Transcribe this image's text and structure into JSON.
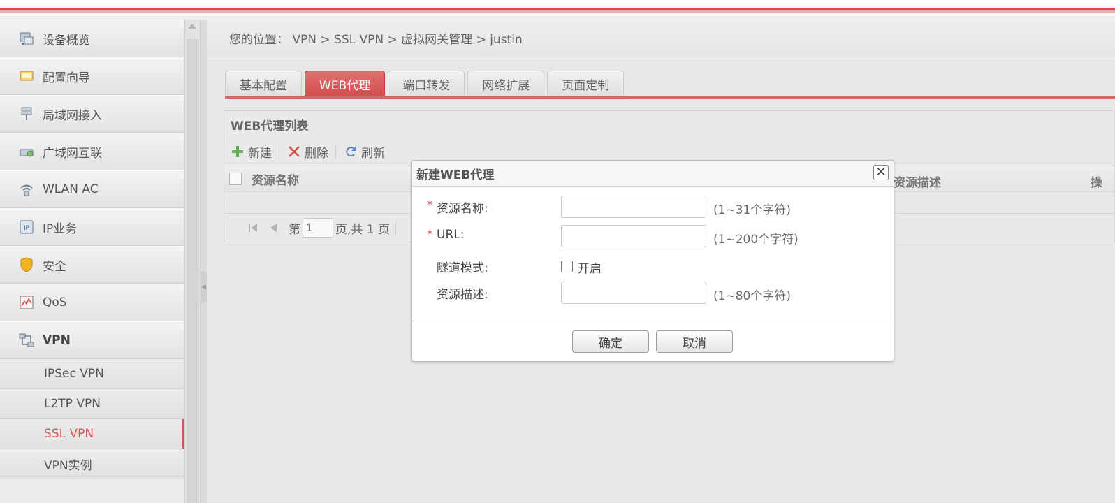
{
  "breadcrumb": "您的位置： VPN > SSL VPN > 虚拟网关管理 > justin",
  "sidebar": {
    "items": [
      {
        "label": "设备概览",
        "icon": "device-overview-icon"
      },
      {
        "label": "配置向导",
        "icon": "config-wizard-icon"
      },
      {
        "label": "局域网接入",
        "icon": "lan-access-icon"
      },
      {
        "label": "广域网互联",
        "icon": "wan-interconnect-icon"
      },
      {
        "label": "WLAN AC",
        "icon": "wlan-icon"
      },
      {
        "label": "IP业务",
        "icon": "ip-service-icon"
      },
      {
        "label": "安全",
        "icon": "shield-icon"
      },
      {
        "label": "QoS",
        "icon": "qos-icon"
      },
      {
        "label": "VPN",
        "icon": "vpn-icon"
      }
    ],
    "vpn_subitems": [
      "IPSec VPN",
      "L2TP VPN",
      "SSL VPN",
      "VPN实例"
    ],
    "selected_subitem": "SSL VPN"
  },
  "tabs": [
    "基本配置",
    "WEB代理",
    "端口转发",
    "网络扩展",
    "页面定制"
  ],
  "active_tab": "WEB代理",
  "panel": {
    "title": "WEB代理列表",
    "toolbar": {
      "new": "新建",
      "delete": "删除",
      "refresh": "刷新"
    },
    "columns": {
      "name": "资源名称",
      "desc": "资源描述",
      "more": "操"
    },
    "pager": {
      "prefix": "第",
      "page_value": "1",
      "suffix": "页,共 1 页"
    }
  },
  "dialog": {
    "title": "新建WEB代理",
    "required_mark": "*",
    "fields": {
      "name": {
        "label": "资源名称:",
        "hint": "(1~31个字符)",
        "value": ""
      },
      "url": {
        "label": "URL:",
        "hint": "(1~200个字符)",
        "value": ""
      },
      "tunnel": {
        "label": "隧道模式:",
        "checkbox_label": "开启",
        "checked": false
      },
      "desc": {
        "label": "资源描述:",
        "hint": "(1~80个字符)",
        "value": ""
      }
    },
    "ok": "确定",
    "cancel": "取消"
  },
  "colors": {
    "accent": "#d24d4d",
    "selected_text": "#d65454"
  }
}
